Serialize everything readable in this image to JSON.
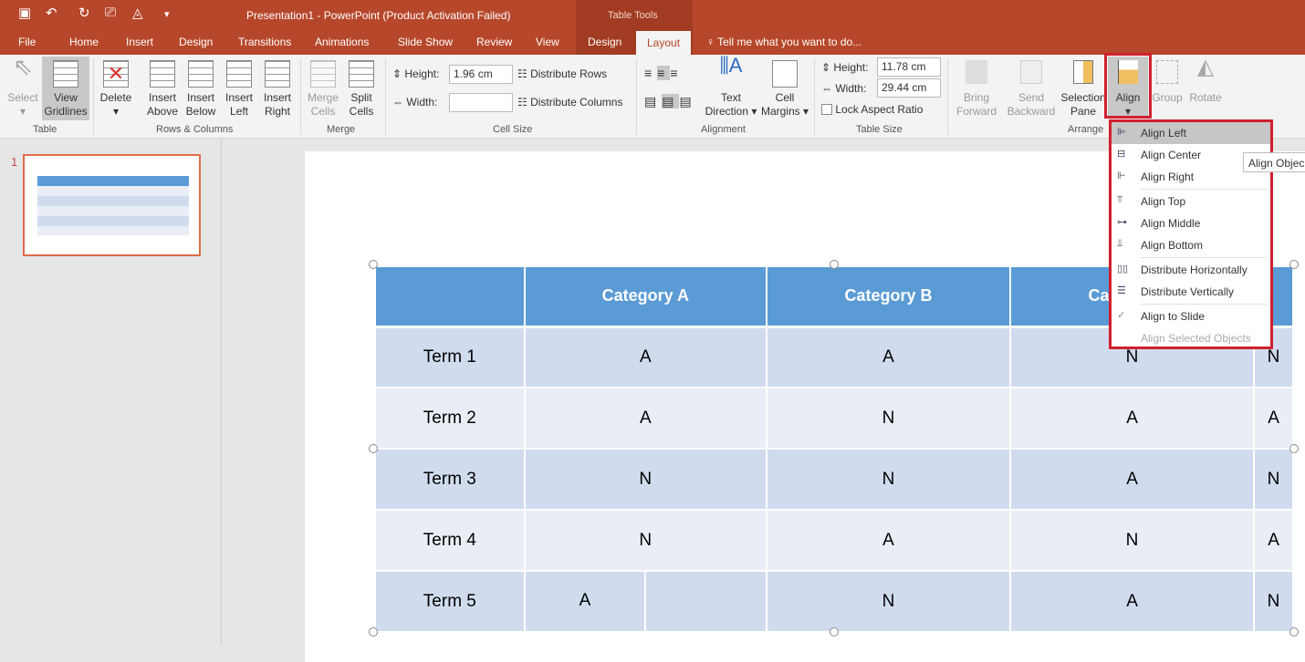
{
  "window": {
    "title": "Presentation1 - PowerPoint (Product Activation Failed)",
    "context_tab": "Table Tools"
  },
  "qat": {
    "save": "save-icon",
    "undo": "undo-icon",
    "redo": "redo-icon",
    "present": "present-icon",
    "paint": "paint-icon",
    "more": "customize-icon"
  },
  "tabs": [
    "File",
    "Home",
    "Insert",
    "Design",
    "Transitions",
    "Animations",
    "Slide Show",
    "Review",
    "View",
    "Design",
    "Layout"
  ],
  "tell_me": "Tell me what you want to do...",
  "ribbon": {
    "table": {
      "select": "Select",
      "view_gridlines": "View Gridlines",
      "group": "Table"
    },
    "rows_cols": {
      "delete": "Delete",
      "insert_above": "Insert Above",
      "insert_below": "Insert Below",
      "insert_left": "Insert Left",
      "insert_right": "Insert Right",
      "group": "Rows & Columns"
    },
    "merge": {
      "merge": "Merge Cells",
      "split": "Split Cells",
      "group": "Merge"
    },
    "cell_size": {
      "height_label": "Height:",
      "height_value": "1.96 cm",
      "width_label": "Width:",
      "width_value": "",
      "distribute_rows": "Distribute Rows",
      "distribute_columns": "Distribute Columns",
      "group": "Cell Size"
    },
    "alignment": {
      "text_direction": "Text Direction",
      "cell_margins": "Cell Margins",
      "group": "Alignment"
    },
    "table_size": {
      "height_label": "Height:",
      "height_value": "11.78 cm",
      "width_label": "Width:",
      "width_value": "29.44 cm",
      "lock": "Lock Aspect Ratio",
      "group": "Table Size"
    },
    "arrange": {
      "bring_forward": "Bring Forward",
      "send_backward": "Send Backward",
      "selection_pane": "Selection Pane",
      "align": "Align",
      "group_btn": "Group",
      "rotate": "Rotate",
      "group": "Arrange"
    }
  },
  "slide_number": "1",
  "table": {
    "headers": [
      "",
      "Category A",
      "Category B",
      "Category C",
      ""
    ],
    "rows": [
      [
        "Term 1",
        "A",
        "A",
        "N",
        "N"
      ],
      [
        "Term 2",
        "A",
        "N",
        "A",
        "A"
      ],
      [
        "Term 3",
        "N",
        "N",
        "A",
        "N"
      ],
      [
        "Term 4",
        "N",
        "A",
        "N",
        "A"
      ],
      [
        "Term 5",
        "A",
        "",
        "N",
        "A",
        "N"
      ]
    ]
  },
  "align_menu": {
    "items": [
      {
        "label": "Align Left",
        "icon": "align-left-icon"
      },
      {
        "label": "Align Center",
        "icon": "align-center-icon"
      },
      {
        "label": "Align Right",
        "icon": "align-right-icon"
      },
      {
        "label": "Align Top",
        "icon": "align-top-icon"
      },
      {
        "label": "Align Middle",
        "icon": "align-middle-icon"
      },
      {
        "label": "Align Bottom",
        "icon": "align-bottom-icon"
      },
      {
        "label": "Distribute Horizontally",
        "icon": "distribute-horizontally-icon"
      },
      {
        "label": "Distribute Vertically",
        "icon": "distribute-vertically-icon"
      },
      {
        "label": "Align to Slide",
        "icon": "check-icon"
      },
      {
        "label": "Align Selected Objects",
        "icon": ""
      }
    ],
    "tooltip": "Align Objec"
  },
  "colors": {
    "accent": "#b7472a",
    "header": "#5b9bd5",
    "highlight": "#d0202e"
  }
}
